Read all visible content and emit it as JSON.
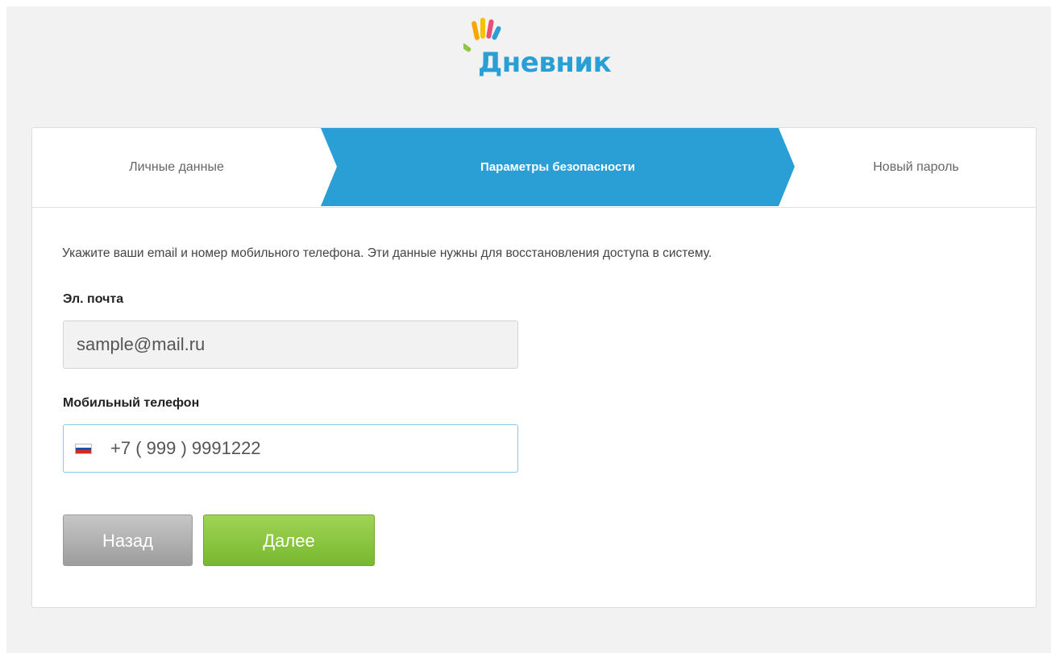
{
  "brand": {
    "name": "Дневник",
    "colors": {
      "primary": "#2a9fd6",
      "success": "#7cbb33",
      "muted": "#a8a8a8"
    }
  },
  "steps": {
    "items": [
      {
        "label": "Личные данные",
        "state": "done"
      },
      {
        "label": "Параметры безопасности",
        "state": "active"
      },
      {
        "label": "Новый пароль",
        "state": "pending"
      }
    ]
  },
  "form": {
    "intro": "Укажите ваши email и номер мобильного телефона. Эти данные нужны для восстановления доступа в систему.",
    "email": {
      "label": "Эл. почта",
      "value": "sample@mail.ru"
    },
    "phone": {
      "label": "Мобильный телефон",
      "value": "+7 ( 999 ) 9991222",
      "flag_icon": "russia-flag-icon"
    }
  },
  "actions": {
    "back_label": "Назад",
    "next_label": "Далее"
  }
}
